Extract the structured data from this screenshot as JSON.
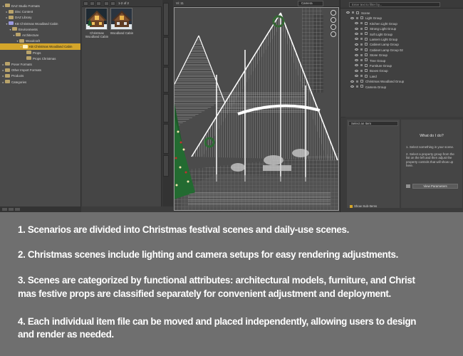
{
  "library": {
    "tree": [
      {
        "label": "DAZ Studio Formats",
        "arrow": "▾",
        "level": 0,
        "selected": false
      },
      {
        "label": "Disc Content",
        "arrow": "▸",
        "level": 1,
        "selected": false
      },
      {
        "label": "DAZ Library",
        "arrow": "▸",
        "level": 1,
        "selected": false
      },
      {
        "label": "KB Christmas Woodland Cabin",
        "arrow": "▾",
        "level": 1,
        "selected": false
      },
      {
        "label": "Environments",
        "arrow": "▾",
        "level": 2,
        "selected": false
      },
      {
        "label": "Architecture",
        "arrow": "▾",
        "level": 3,
        "selected": false
      },
      {
        "label": "Woodcraft",
        "arrow": "▾",
        "level": 4,
        "selected": false
      },
      {
        "label": "KB Christmas Woodland Cabin",
        "arrow": "▾",
        "level": 5,
        "selected": true
      },
      {
        "label": "Props",
        "arrow": "",
        "level": 6,
        "selected": false
      },
      {
        "label": "Props Christmas",
        "arrow": "",
        "level": 6,
        "selected": false
      },
      {
        "label": "Poser Formats",
        "arrow": "▸",
        "level": 0,
        "selected": false
      },
      {
        "label": "Other Import Formats",
        "arrow": "▸",
        "level": 0,
        "selected": false
      },
      {
        "label": "Products",
        "arrow": "▸",
        "level": 0,
        "selected": false
      },
      {
        "label": "Categories",
        "arrow": "▸",
        "level": 0,
        "selected": false
      }
    ]
  },
  "thumbnails": {
    "page_indicator": "1-2 of 2",
    "items": [
      {
        "label": "Christmas Woodland Cabin"
      },
      {
        "label": "Woodland Cabin"
      }
    ]
  },
  "viewport": {
    "label": "Vi: 11",
    "camera": "Camera"
  },
  "scene": {
    "search_placeholder": "Enter text to filter by...",
    "items": [
      {
        "label": "Scene",
        "level": 0
      },
      {
        "label": "Light Group",
        "level": 1
      },
      {
        "label": "Kitchen Light Group",
        "level": 2
      },
      {
        "label": "Strong Light Group",
        "level": 2
      },
      {
        "label": "Soft Light Group",
        "level": 2
      },
      {
        "label": "Lantern Light Group",
        "level": 2
      },
      {
        "label": "Cabinet Lamp Group",
        "level": 2
      },
      {
        "label": "Cabinet Lamp Group 02",
        "level": 2
      },
      {
        "label": "Stone Group",
        "level": 2
      },
      {
        "label": "Tree Group",
        "level": 2
      },
      {
        "label": "Furniture Group",
        "level": 2
      },
      {
        "label": "Boxes Group",
        "level": 2
      },
      {
        "label": "Land",
        "level": 2
      },
      {
        "label": "Christmas Woodland Group",
        "level": 1
      },
      {
        "label": "Camera Group",
        "level": 1
      }
    ]
  },
  "tool_settings": {
    "select_label": "Select an Item",
    "show_subitems": "Show Sub-Items",
    "help_title": "What do I do?",
    "steps": [
      "1. Select something in your scene.",
      "2. Select a property group from the list on the left and then adjust the property controls that will show up here."
    ],
    "params_button": "View Parameters"
  },
  "info": {
    "lines": [
      "1.    Scenarios are divided into Christmas festival scenes and daily-use scenes.",
      "2.   Christmas scenes include lighting and camera setups for easy rendering adjustments.",
      "3.   Scenes are categorized by functional attributes: architectural models, furniture, and    Christ",
      "mas festive props are classified separately for convenient adjustment and deployment.",
      "4.   Each individual item file can be moved and placed independently, allowing users to design",
      "and render as needed."
    ]
  }
}
